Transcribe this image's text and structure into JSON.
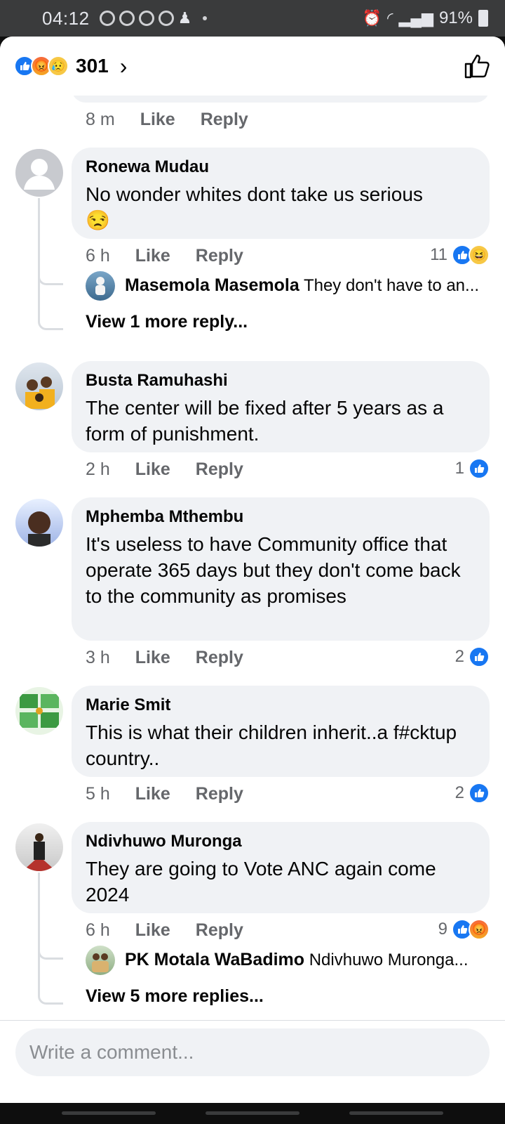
{
  "status_bar": {
    "time": "04:12",
    "battery": "91%"
  },
  "header": {
    "reaction_count": "301",
    "reactions": [
      "like",
      "angry",
      "sad"
    ],
    "chevron": "›"
  },
  "previous_comment": {
    "time": "8 m",
    "like_label": "Like",
    "reply_label": "Reply"
  },
  "comments": [
    {
      "name": "Ronewa Mudau",
      "text": "No wonder whites dont take us serious",
      "emoji": "😒",
      "time": "6 h",
      "like_label": "Like",
      "reply_label": "Reply",
      "reaction_count": "11",
      "reactions": [
        "like",
        "haha"
      ],
      "reply_preview": {
        "name": "Masemola Masemola",
        "text": "They don't have to an..."
      },
      "view_more": "View 1 more reply..."
    },
    {
      "name": "Busta Ramuhashi",
      "text": "The center will be fixed after 5 years as a form of punishment.",
      "time": "2 h",
      "like_label": "Like",
      "reply_label": "Reply",
      "reaction_count": "1",
      "reactions": [
        "like"
      ]
    },
    {
      "name": "Mphemba Mthembu",
      "text": "It's useless to have Community office that operate 365 days but they don't come back to the community as promises",
      "time": "3 h",
      "like_label": "Like",
      "reply_label": "Reply",
      "reaction_count": "2",
      "reactions": [
        "like"
      ]
    },
    {
      "name": "Marie Smit",
      "text": "This is what their children inherit..a f#cktup country..",
      "time": "5 h",
      "like_label": "Like",
      "reply_label": "Reply",
      "reaction_count": "2",
      "reactions": [
        "like"
      ]
    },
    {
      "name": "Ndivhuwo Muronga",
      "text": "They are going to Vote ANC again come 2024",
      "time": "6 h",
      "like_label": "Like",
      "reply_label": "Reply",
      "reaction_count": "9",
      "reactions": [
        "like",
        "angry"
      ],
      "reply_preview": {
        "name": "PK Motala WaBadimo",
        "text": "Ndivhuwo Muronga..."
      },
      "view_more": "View 5 more replies..."
    }
  ],
  "composer": {
    "placeholder": "Write a comment..."
  },
  "colors": {
    "like": "#1877f2",
    "bubble": "#f0f2f5",
    "meta": "#65676b"
  }
}
